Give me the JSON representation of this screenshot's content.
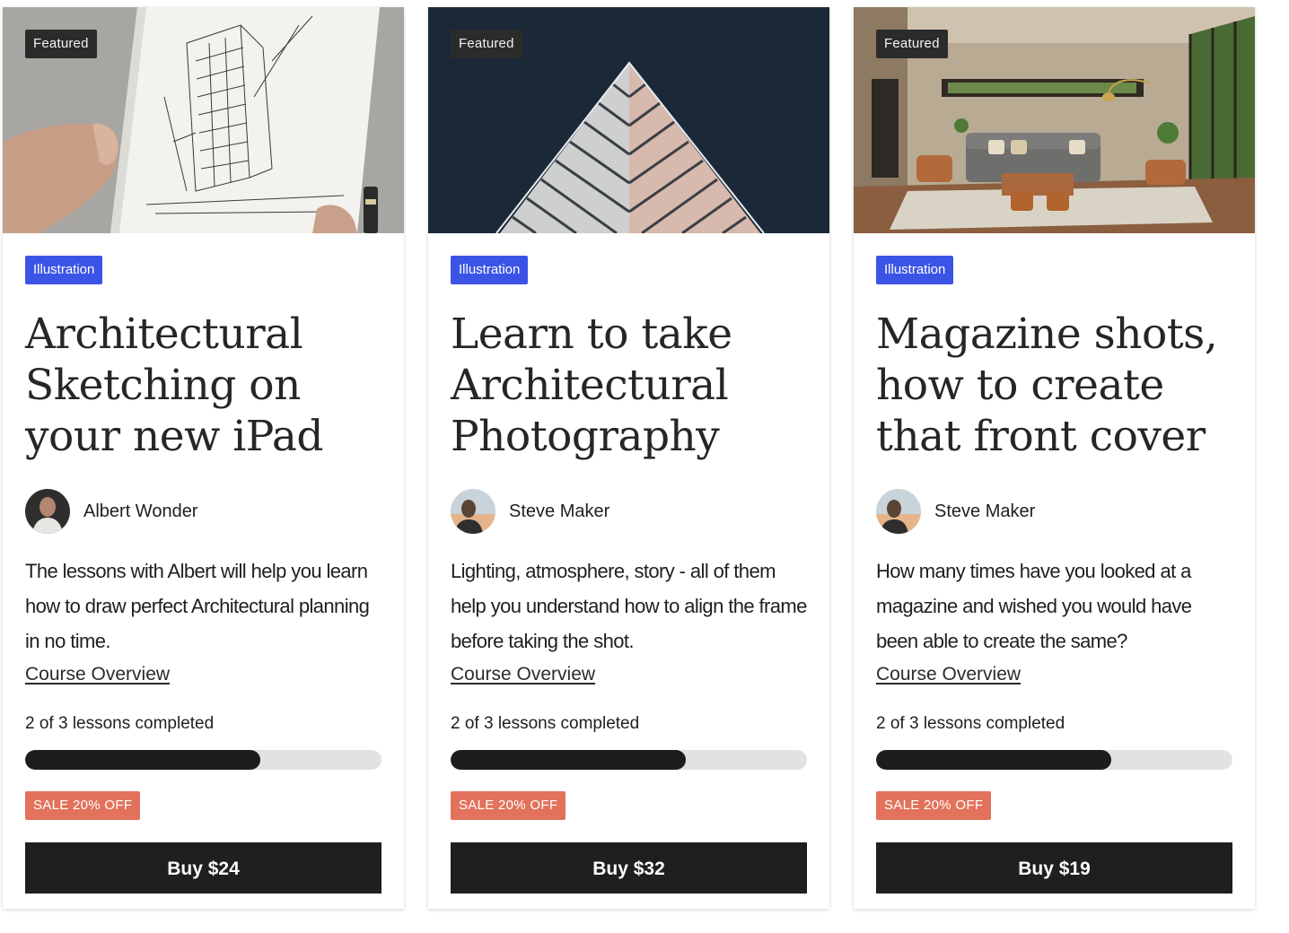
{
  "cards": [
    {
      "badge": "Featured",
      "image": "hand-sketching-building-illustration",
      "category": "Illustration",
      "title": "Architectural Sketching on your new iPad",
      "author": "Albert Wonder",
      "description": "The lessons with Albert will help you learn how to draw perfect Architectural planning in no time.",
      "overview_link": "Course Overview",
      "progress_text": "2 of 3 lessons completed",
      "progress": 0.66,
      "sale": "SALE 20% OFF",
      "buy_label": "Buy $24"
    },
    {
      "badge": "Featured",
      "image": "triangular-building-facade-photo",
      "category": "Illustration",
      "title": "Learn to take Architectural Photography",
      "author": "Steve Maker",
      "description": "Lighting, atmosphere, story - all of them help you understand how to align the frame before taking the shot.",
      "overview_link": "Course Overview",
      "progress_text": "2 of 3 lessons completed",
      "progress": 0.66,
      "sale": "SALE 20% OFF",
      "buy_label": "Buy $32"
    },
    {
      "badge": "Featured",
      "image": "living-room-interior-photo",
      "category": "Illustration",
      "title": "Magazine shots, how to create that front cover",
      "author": "Steve Maker",
      "description": "How many times have you looked at a magazine and wished you would have been able to create the same?",
      "overview_link": "Course Overview",
      "progress_text": "2 of 3 lessons completed",
      "progress": 0.66,
      "sale": "SALE 20% OFF",
      "buy_label": "Buy $19"
    }
  ],
  "colors": {
    "category_badge": "#3c54e6",
    "featured_badge": "#2b2b2b",
    "sale_badge": "#e2725b",
    "buy_button": "#1f1f1f",
    "progress_fill": "#1d1d1d",
    "progress_track": "#e2e2e2"
  }
}
